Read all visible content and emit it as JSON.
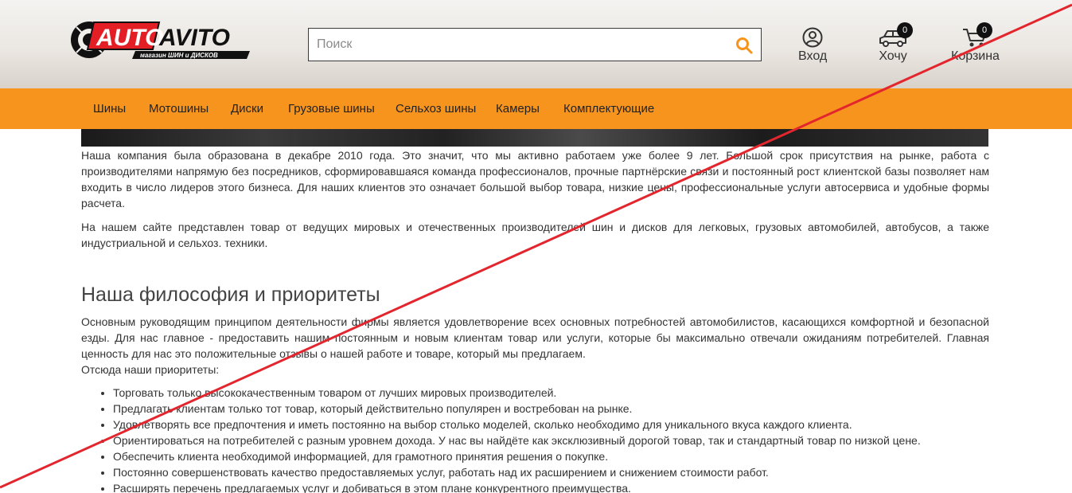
{
  "header": {
    "logo": {
      "auto": "AUTO",
      "avito": "AVITO",
      "tagline": "магазин ШИН и ДИСКОВ"
    },
    "search": {
      "placeholder": "Поиск",
      "value": ""
    },
    "login_label": "Вход",
    "wish": {
      "label": "Хочу",
      "count": "0"
    },
    "cart": {
      "label": "Корзина",
      "count": "0"
    }
  },
  "nav": {
    "items": [
      "Шины",
      "Мотошины",
      "Диски",
      "Грузовые шины",
      "Сельхоз шины",
      "Камеры",
      "Комплектующие"
    ]
  },
  "content": {
    "intro_p1": "Наша компания была образована в декабре 2010 года. Это значит, что мы активно работаем уже более 9 лет. Большой срок присутствия на рынке, работа с производителями напрямую без посредников, сформировавшаяся команда профессионалов, прочные партнёрские связи и постоянный рост клиентской базы позволяет нам входить в число лидеров этого бизнеса. Для наших клиентов это означает большой выбор товара, низкие цены, профессиональные услуги автосервиса и удобные формы расчета.",
    "intro_p2": "На нашем сайте представлен товар от ведущих мировых и отечественных производителей шин и дисков для легковых, грузовых автомобилей, автобусов, а также индустриальной и сельхоз. техники.",
    "heading": "Наша философия и приоритеты",
    "philosophy_p": "Основным руководящим принципом деятельности фирмы является удовлетворение всех основных потребностей автомобилистов, касающихся комфортной и безопасной езды. Для нас главное - предоставить нашим постоянным и новым клиентам товар или услуги, которые бы максимально отвечали ожиданиям потребителей. Главная ценность для нас это положительные отзывы о нашей работе и товаре, который мы предлагаем.",
    "priorities_intro": "Отсюда наши приоритеты:",
    "priorities": [
      "Торговать только высококачественным товаром от лучших мировых производителей.",
      "Предлагать клиентам только тот товар, который действительно популярен и востребован на рынке.",
      "Удовлетворять все предпочтения и иметь постоянно на выбор столько моделей, сколько необходимо для уникального вкуса каждого клиента.",
      "Ориентироваться на потребителей с разным уровнем дохода. У нас вы найдёте как эксклюзивный дорогой товар, так и стандартный товар по низкой цене.",
      "Обеспечить клиента необходимой информацией, для грамотного принятия решения о покупке.",
      "Постоянно совершенствовать качество предоставляемых услуг, работать над их расширением и снижением стоимости работ.",
      "Расширять перечень предлагаемых услуг и добиваться в этом плане конкурентного преимущества."
    ]
  },
  "colors": {
    "nav_bg": "#f7941d",
    "accent": "#f7941d",
    "logo_red": "#e31e24",
    "strike_line": "#e3262e"
  },
  "icons": [
    "logo-tire-icon",
    "search-icon",
    "user-icon",
    "car-icon",
    "cart-icon"
  ]
}
